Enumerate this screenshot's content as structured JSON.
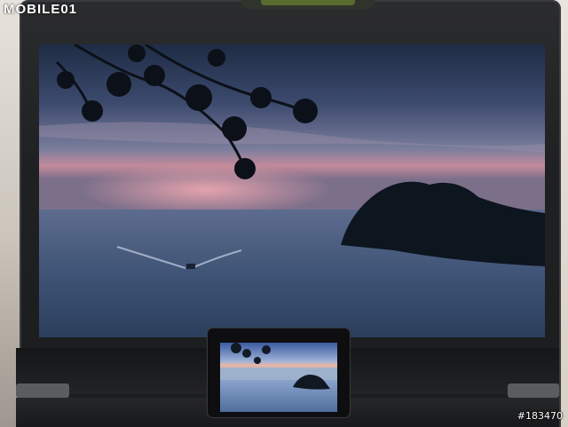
{
  "watermark": {
    "brand": "MOBILE01",
    "photo_id": "#183470"
  },
  "scene": {
    "colors": {
      "sky_top": "#26344f",
      "sky_mid": "#6f7697",
      "horizon_glow": "#d98a95",
      "sea": "#3d4f6c",
      "island": "#0d151f",
      "bezel": "#1d1e20"
    }
  }
}
